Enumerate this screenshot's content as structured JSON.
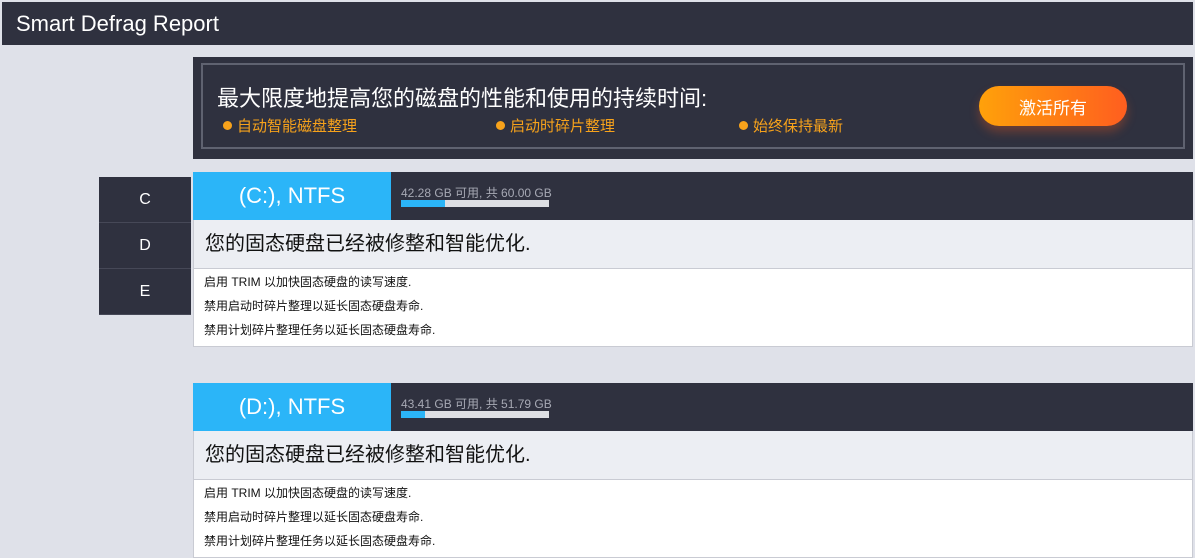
{
  "title": "Smart Defrag Report",
  "promo": {
    "headline": "最大限度地提高您的磁盘的性能和使用的持续时间:",
    "features": [
      "自动智能磁盘整理",
      "启动时碎片整理",
      "始终保持最新"
    ],
    "button": "激活所有"
  },
  "tabs": [
    "C",
    "D",
    "E"
  ],
  "drives": [
    {
      "name": "(C:), NTFS",
      "info": "42.28 GB 可用, 共 60.00 GB",
      "used_fraction": 0.295,
      "status": "您的固态硬盘已经被修整和智能优化.",
      "items": [
        "启用 TRIM 以加快固态硬盘的读写速度.",
        "禁用启动时碎片整理以延长固态硬盘寿命.",
        "禁用计划碎片整理任务以延长固态硬盘寿命."
      ]
    },
    {
      "name": "(D:), NTFS",
      "info": "43.41 GB 可用, 共 51.79 GB",
      "used_fraction": 0.162,
      "status": "您的固态硬盘已经被修整和智能优化.",
      "items": [
        "启用 TRIM 以加快固态硬盘的读写速度.",
        "禁用启动时碎片整理以延长固态硬盘寿命.",
        "禁用计划碎片整理任务以延长固态硬盘寿命."
      ]
    }
  ]
}
